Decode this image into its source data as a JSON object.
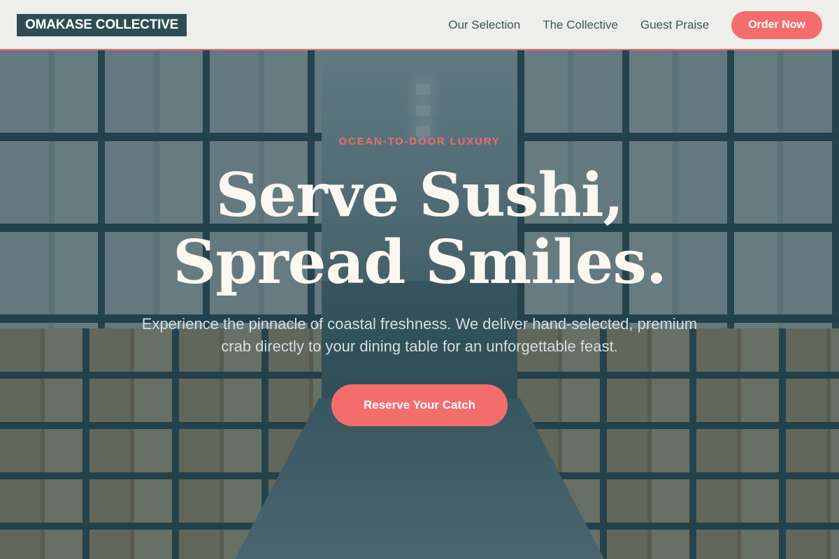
{
  "brand": {
    "logo_text": "OMAKASE COLLECTIVE"
  },
  "nav": {
    "links": [
      {
        "label": "Our Selection"
      },
      {
        "label": "The Collective"
      },
      {
        "label": "Guest Praise"
      }
    ],
    "order_button": "Order Now"
  },
  "hero": {
    "eyebrow": "OCEAN-TO-DOOR LUXURY",
    "headline_line1": "Serve Sushi,",
    "headline_line2": "Spread Smiles.",
    "subtext": "Experience the pinnacle of coastal freshness. We deliver hand-selected, premium crab directly to your dining table for an unforgettable feast.",
    "cta_label": "Reserve Your Catch",
    "background": "warehouse-aisle-photo"
  },
  "colors": {
    "accent": "#f46d6d",
    "header_bg": "#eeeeec",
    "logo_bg": "#2d4d52",
    "overlay": "#22404a",
    "headline": "#fbf7f1"
  }
}
